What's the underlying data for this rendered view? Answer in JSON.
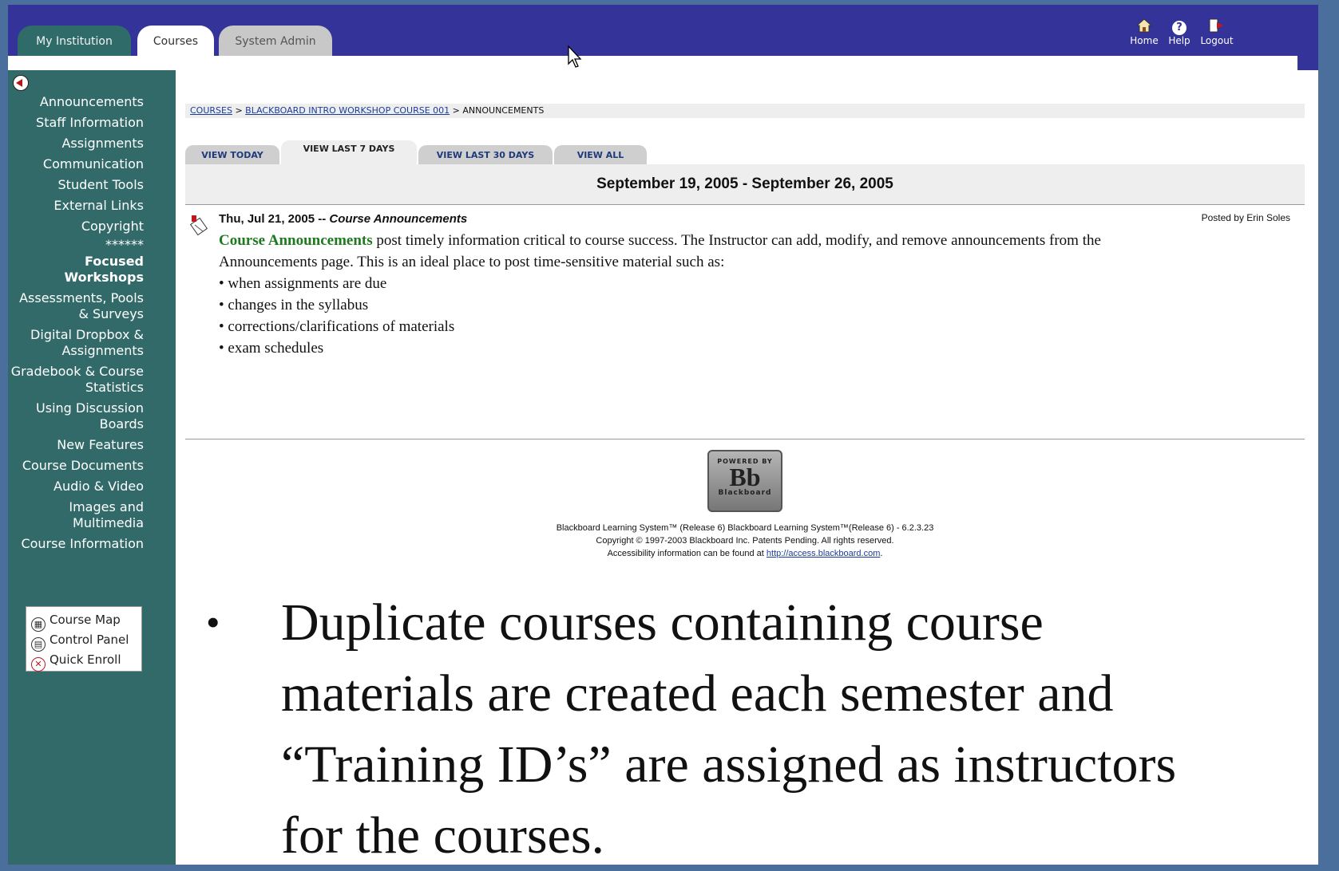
{
  "header": {
    "tabs": [
      {
        "label": "My Institution"
      },
      {
        "label": "Courses",
        "active": true
      },
      {
        "label": "System Admin"
      }
    ],
    "tools": {
      "home": "Home",
      "help": "Help",
      "logout": "Logout"
    },
    "colors": {
      "topbar": "#333399",
      "sidebar": "#326a6a"
    }
  },
  "sidebar": {
    "items": [
      "Announcements",
      "Staff Information",
      "Assignments",
      "Communication",
      "Student Tools",
      "External Links",
      "Copyright",
      "******",
      "Focused Workshops",
      "Assessments, Pools & Surveys",
      "Digital Dropbox & Assignments",
      "Gradebook & Course Statistics",
      "Using Discussion Boards",
      "New Features",
      "Course Documents",
      "Audio & Video",
      "Images and Multimedia",
      "Course Information"
    ],
    "tools": [
      "Course Map",
      "Control Panel",
      "Quick Enroll"
    ]
  },
  "breadcrumb": {
    "courses": "COURSES",
    "course": "BLACKBOARD INTRO WORKSHOP COURSE 001",
    "current": "ANNOUNCEMENTS",
    "sep": ">"
  },
  "view_tabs": [
    "VIEW TODAY",
    "VIEW LAST 7 DAYS",
    "VIEW LAST 30 DAYS",
    "VIEW ALL"
  ],
  "date_range": "September 19, 2005 - September 26, 2005",
  "announcement": {
    "date": "Thu, Jul 21, 2005",
    "dash": "--",
    "title": "Course Announcements",
    "posted_by": "Posted by Erin Soles",
    "highlight": "Course Announcements",
    "text": "post timely information critical to course success. The Instructor can add, modify, and remove announcements from the Announcements page. This is an ideal place to post time-sensitive material such as:",
    "bullets": [
      "when assignments are due",
      "changes in the syllabus",
      "corrections/clarifications of materials",
      "exam schedules"
    ]
  },
  "logo": {
    "powered": "POWERED BY",
    "bb": "Bb",
    "name": "Blackboard"
  },
  "footer": {
    "line1": "Blackboard Learning System™ (Release 6) Blackboard Learning System™(Release 6) - 6.2.3.23",
    "line2": "Copyright © 1997-2003 Blackboard Inc. Patents Pending. All rights reserved.",
    "line3_prefix": "Accessibility information can be found at",
    "link": "http://access.blackboard.com",
    "line3_suffix": "."
  },
  "slide": {
    "bullet": "•",
    "lines": [
      "Duplicate courses containing course",
      "materials are created each semester and",
      "“Training ID’s” are assigned as instructors",
      "for the courses."
    ]
  }
}
